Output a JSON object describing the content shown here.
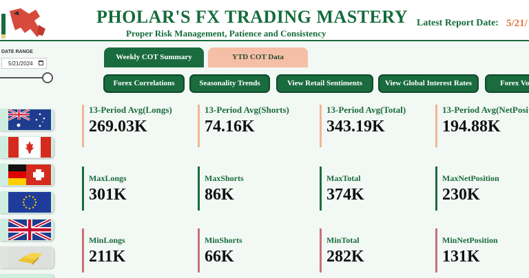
{
  "header": {
    "title": "PHOLAR'S FX TRADING MASTERY",
    "subtitle": "Proper Risk Management, Patience and Consistency",
    "report_label": "Latest Report Date:",
    "report_date": "5/21/"
  },
  "filters": {
    "date_range_label": "DATE RANGE",
    "date_value": "5/21/2024"
  },
  "tabs": [
    {
      "label": "Weekly COT Summary",
      "active": true
    },
    {
      "label": "YTD COT Data",
      "active": false
    }
  ],
  "nav_buttons": [
    {
      "label": "Forex Correlations"
    },
    {
      "label": "Seasonality Trends"
    },
    {
      "label": "View Retail Sentiments"
    },
    {
      "label": "View Global Interest Rates"
    },
    {
      "label": "Forex Vo"
    }
  ],
  "currencies": [
    {
      "icon": "australia-flag-icon"
    },
    {
      "icon": "canada-flag-icon"
    },
    {
      "icon": "germany-switzerland-flag-icon"
    },
    {
      "icon": "european-union-flag-icon"
    },
    {
      "icon": "united-kingdom-flag-icon"
    },
    {
      "icon": "gold-bar-icon"
    }
  ],
  "kpis": {
    "row1": [
      {
        "label": "13-Period Avg(Longs)",
        "value": "269.03K"
      },
      {
        "label": "13-Period Avg(Shorts)",
        "value": "74.16K"
      },
      {
        "label": "13-Period Avg(Total)",
        "value": "343.19K"
      },
      {
        "label": "13-Period Avg(NetPosit",
        "value": "194.88K"
      }
    ],
    "row2": [
      {
        "label": "MaxLongs",
        "value": "301K"
      },
      {
        "label": "MaxShorts",
        "value": "86K"
      },
      {
        "label": "MaxTotal",
        "value": "374K"
      },
      {
        "label": "MaxNetPosition",
        "value": "230K"
      }
    ],
    "row3": [
      {
        "label": "MinLongs",
        "value": "211K"
      },
      {
        "label": "MinShorts",
        "value": "66K"
      },
      {
        "label": "MinTotal",
        "value": "282K"
      },
      {
        "label": "MinNetPosition",
        "value": "131K"
      }
    ]
  },
  "colors": {
    "brand_green": "#1a6b3e",
    "accent_orange": "#e07840",
    "peach": "#f4bfa6",
    "row3_bar": "#c97079"
  }
}
